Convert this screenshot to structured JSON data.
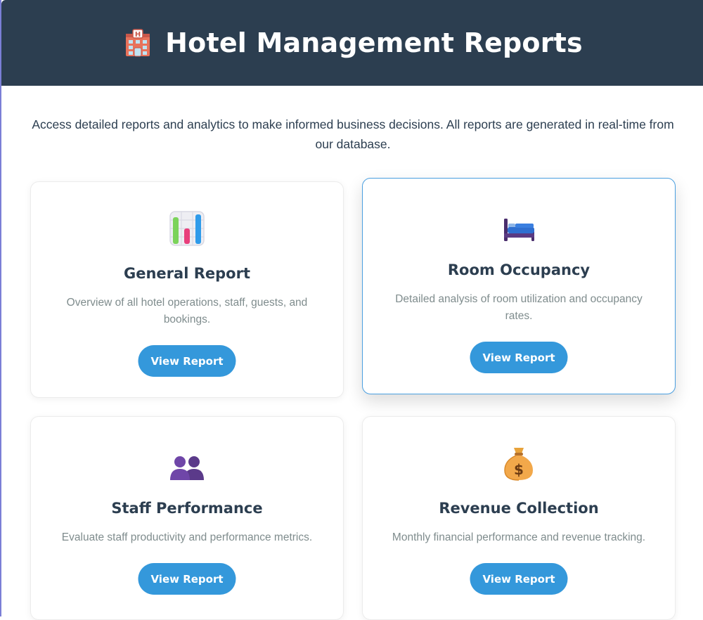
{
  "header": {
    "title": "Hotel Management Reports",
    "icon": "hotel-icon"
  },
  "intro": "Access detailed reports and analytics to make informed business decisions. All reports are generated in real-time from our database.",
  "colors": {
    "header_bg": "#2c3e50",
    "accent": "#3498db",
    "title_text": "#2c3e50",
    "muted_text": "#7f8c8d"
  },
  "cards": [
    {
      "title": "General Report",
      "description": "Overview of all hotel operations, staff, guests, and bookings.",
      "button": "View Report",
      "icon": "bar-chart-icon"
    },
    {
      "title": "Room Occupancy",
      "description": "Detailed analysis of room utilization and occupancy rates.",
      "button": "View Report",
      "icon": "bed-icon"
    },
    {
      "title": "Staff Performance",
      "description": "Evaluate staff productivity and performance metrics.",
      "button": "View Report",
      "icon": "people-icon"
    },
    {
      "title": "Revenue Collection",
      "description": "Monthly financial performance and revenue tracking.",
      "button": "View Report",
      "icon": "money-bag-icon"
    }
  ]
}
